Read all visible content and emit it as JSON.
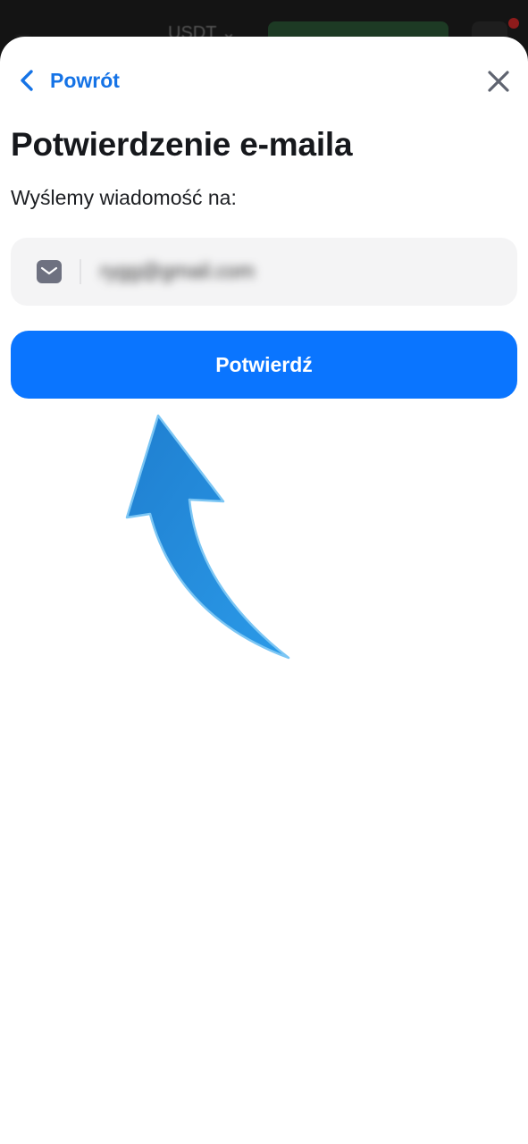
{
  "background_header": {
    "currency": "USDT"
  },
  "nav": {
    "back_label": "Powrót"
  },
  "page": {
    "title": "Potwierdzenie e-maila",
    "subtitle": "Wyślemy wiadomość na:"
  },
  "email": {
    "value": "rygg@gmail.com"
  },
  "actions": {
    "confirm_label": "Potwierdź"
  },
  "colors": {
    "accent": "#0a75ff",
    "link": "#1573e6",
    "arrow": "#2a8fe0"
  },
  "icons": [
    "chevron-left-icon",
    "close-icon",
    "mail-icon",
    "arrow-annotation"
  ]
}
